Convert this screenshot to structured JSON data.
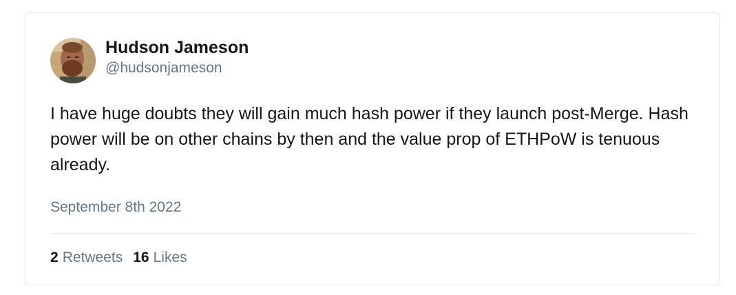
{
  "author": {
    "display_name": "Hudson Jameson",
    "handle": "@hudsonjameson"
  },
  "tweet": {
    "text": "I have huge doubts they will gain much hash power if they launch post-Merge. Hash power will be on other chains by then and the value prop of ETHPoW is tenuous already.",
    "timestamp": "September 8th 2022"
  },
  "stats": {
    "retweets_count": "2",
    "retweets_label": "Retweets",
    "likes_count": "16",
    "likes_label": "Likes"
  },
  "colors": {
    "primary_text": "#14171a",
    "secondary_text": "#657786",
    "border": "#e1e8ed"
  }
}
